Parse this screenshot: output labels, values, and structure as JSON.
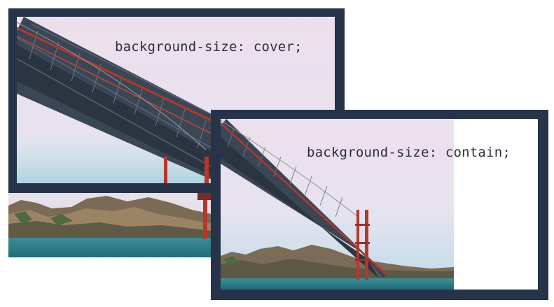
{
  "cover_demo": {
    "label": "background-size: cover;"
  },
  "contain_demo": {
    "label": "background-size: contain;"
  },
  "colors": {
    "frame": "#273348",
    "sky": "#e9dfec",
    "water": "#2a7d88",
    "bridge": "#b5372c",
    "label_text": "#2a2f3a"
  }
}
